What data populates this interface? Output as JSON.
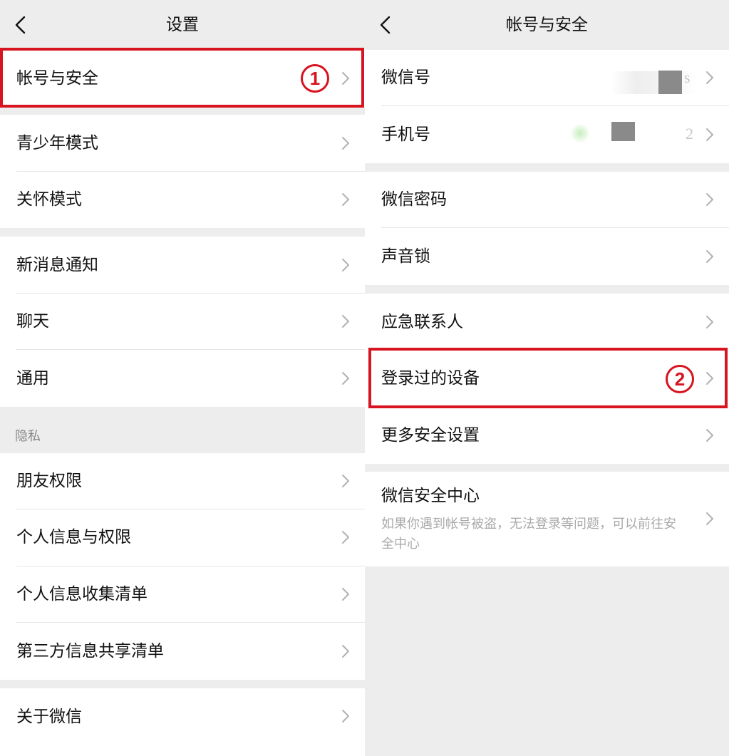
{
  "left": {
    "header": {
      "title": "设置"
    },
    "items": [
      {
        "label": "帐号与安全"
      },
      {
        "label": "青少年模式"
      },
      {
        "label": "关怀模式"
      },
      {
        "label": "新消息通知"
      },
      {
        "label": "聊天"
      },
      {
        "label": "通用"
      },
      {
        "label": "朋友权限"
      },
      {
        "label": "个人信息与权限"
      },
      {
        "label": "个人信息收集清单"
      },
      {
        "label": "第三方信息共享清单"
      },
      {
        "label": "关于微信"
      }
    ],
    "privacy_section_label": "隐私",
    "annotation_badge": "1"
  },
  "right": {
    "header": {
      "title": "帐号与安全"
    },
    "items": [
      {
        "label": "微信号",
        "value_hint": "s"
      },
      {
        "label": "手机号",
        "value_hint": "2"
      },
      {
        "label": "微信密码"
      },
      {
        "label": "声音锁"
      },
      {
        "label": "应急联系人"
      },
      {
        "label": "登录过的设备"
      },
      {
        "label": "更多安全设置"
      },
      {
        "label": "微信安全中心",
        "description": "如果你遇到帐号被盗，无法登录等问题，可以前往安全中心"
      }
    ],
    "annotation_badge": "2"
  },
  "colors": {
    "background": "#ededed",
    "row_bg": "#ffffff",
    "highlight": "#d7141f",
    "chevron": "#b2b2b2"
  },
  "icons": [
    "back-arrow-icon",
    "chevron-right-icon"
  ]
}
